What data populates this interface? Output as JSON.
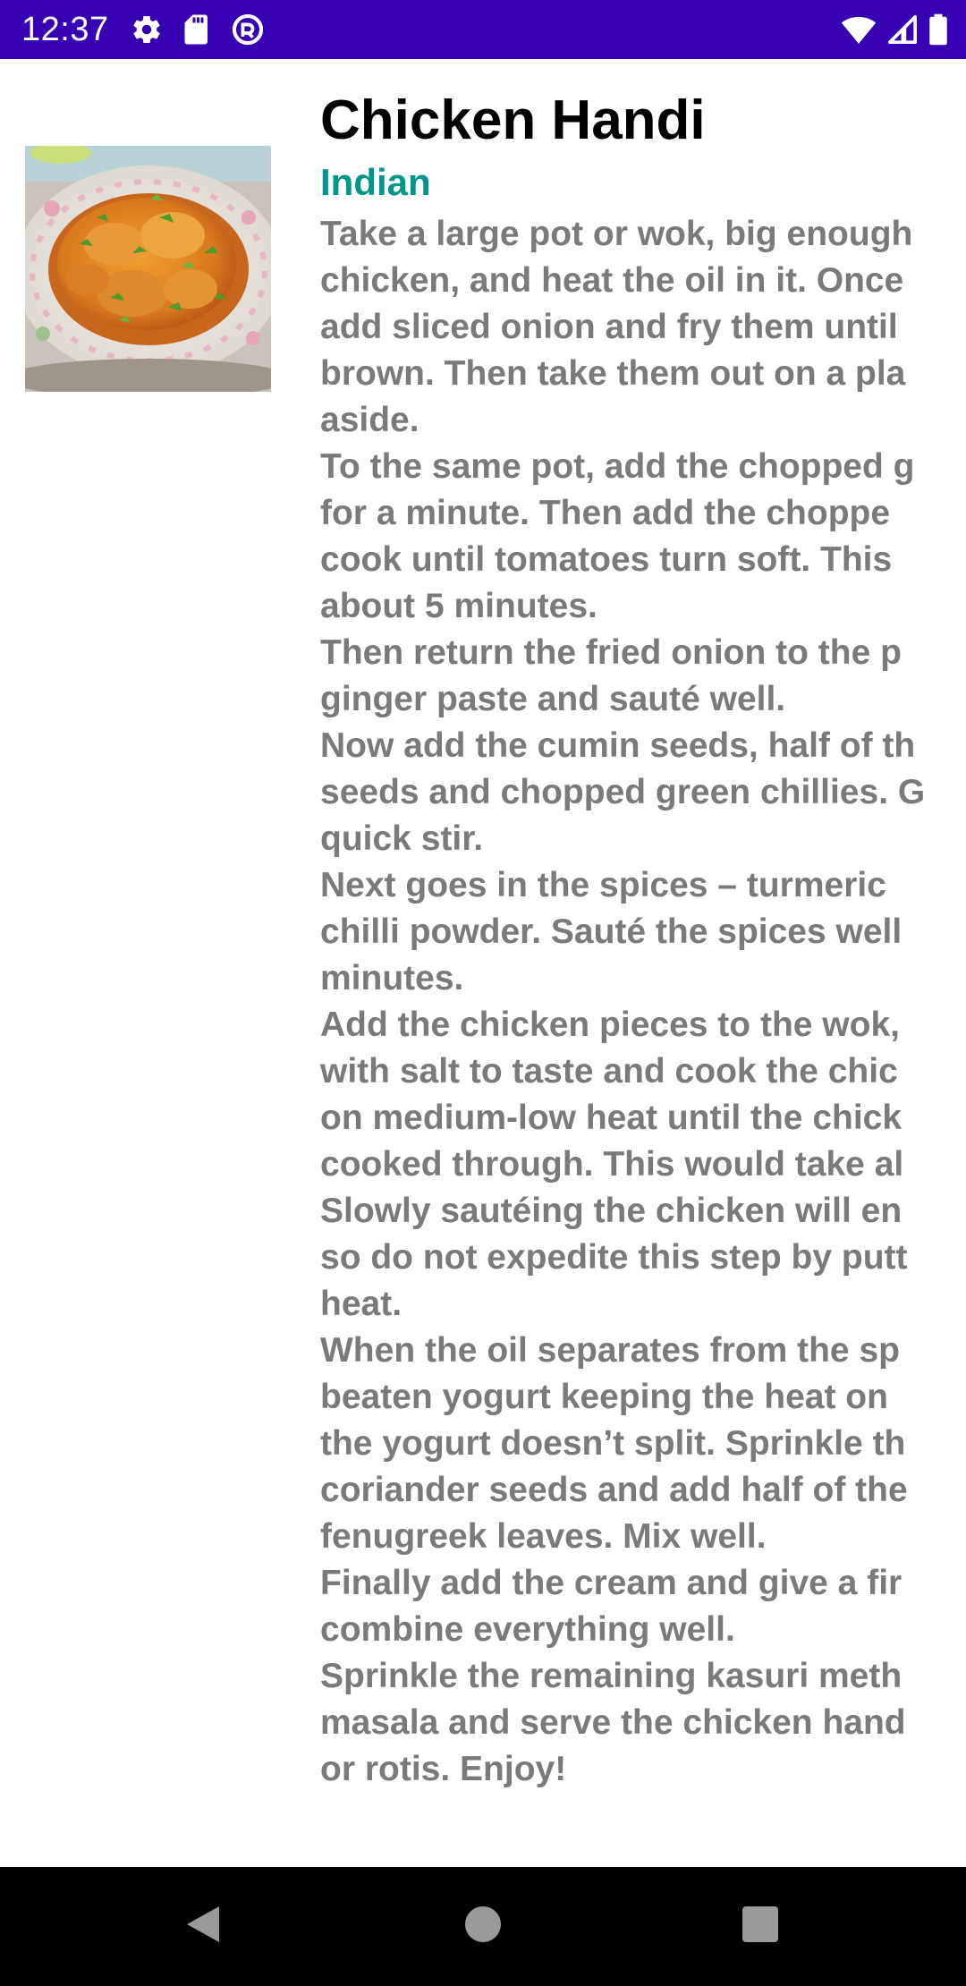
{
  "status_bar": {
    "time": "12:37",
    "left_icons": [
      "settings-icon",
      "sd-card-icon",
      "vpn-icon"
    ],
    "right_icons": [
      "wifi-icon",
      "cell-signal-icon",
      "battery-icon"
    ],
    "background": "#3700b3"
  },
  "recipe": {
    "title": "Chicken Handi",
    "cuisine": "Indian",
    "cuisine_color": "#009688",
    "image": "chicken-handi-photo",
    "instructions": [
      "Take a large pot or wok, big enough",
      "chicken, and heat the oil in it. Once",
      "add sliced onion and fry them until",
      "brown. Then take them out on a pla",
      "aside.",
      "To the same pot, add the chopped g",
      "for a minute. Then add the choppe",
      "cook until tomatoes turn soft. This",
      "about 5 minutes.",
      "Then return the fried onion to the p",
      "ginger paste and sauté well.",
      "Now add the cumin seeds, half of th",
      "seeds and chopped green chillies. G",
      "quick stir.",
      "Next goes in the spices – turmeric",
      "chilli powder. Sauté the spices well",
      "minutes.",
      "Add the chicken pieces to the wok,",
      "with salt to taste and cook the chic",
      "on medium-low heat until the chick",
      "cooked through. This would take al",
      "Slowly sautéing the chicken will en",
      "so do not expedite this step by putt",
      "heat.",
      "When the oil separates from the sp",
      "beaten yogurt keeping the heat on",
      "the yogurt doesn’t split. Sprinkle th",
      "coriander seeds and add half of the",
      "fenugreek leaves. Mix well.",
      "Finally add the cream and give a fir",
      "combine everything well.",
      "Sprinkle the remaining kasuri meth",
      "masala and serve the chicken hand",
      "or rotis. Enjoy!"
    ]
  },
  "nav_bar": {
    "buttons": [
      "back-icon",
      "home-icon",
      "recents-icon"
    ]
  }
}
